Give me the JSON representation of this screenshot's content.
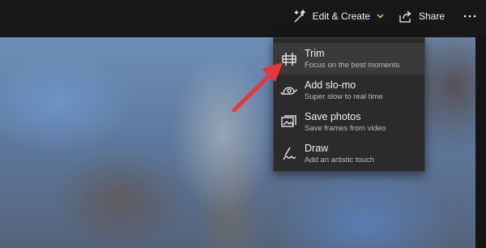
{
  "toolbar": {
    "edit_create": "Edit & Create",
    "share": "Share"
  },
  "menu": {
    "items": [
      {
        "title": "Trim",
        "subtitle": "Focus on the best moments"
      },
      {
        "title": "Add slo-mo",
        "subtitle": "Super slow to real time"
      },
      {
        "title": "Save photos",
        "subtitle": "Save frames from video"
      },
      {
        "title": "Draw",
        "subtitle": "Add an artistic touch"
      }
    ]
  },
  "colors": {
    "accent": "#e8e06a",
    "arrow": "#e8353b"
  }
}
